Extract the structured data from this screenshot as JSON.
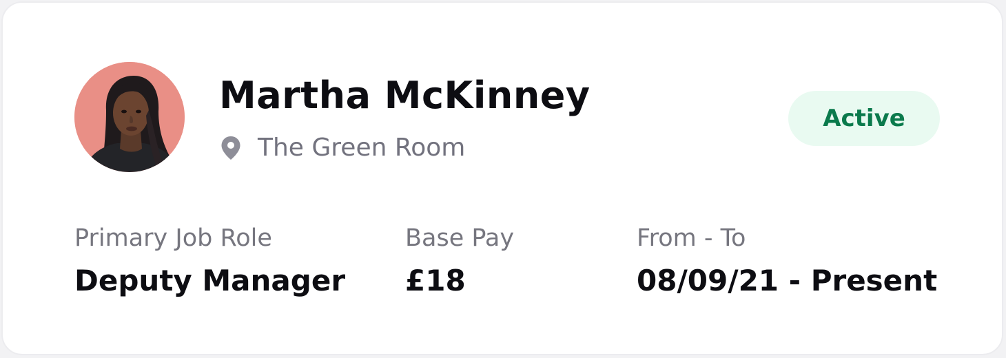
{
  "profile": {
    "name": "Martha McKinney",
    "location": "The Green Room",
    "status": "Active",
    "avatar_icon": "avatar-photo",
    "location_icon": "map-pin-icon"
  },
  "details": {
    "role_label": "Primary Job Role",
    "role_value": "Deputy Manager",
    "pay_label": "Base Pay",
    "pay_value": "£18",
    "dates_label": "From - To",
    "dates_value": "08/09/21 - Present"
  },
  "colors": {
    "status_bg": "#e9faf1",
    "status_text": "#0b7a4c",
    "muted_text": "#72727e",
    "primary_text": "#0d0d12",
    "avatar_bg": "#e98f86"
  }
}
